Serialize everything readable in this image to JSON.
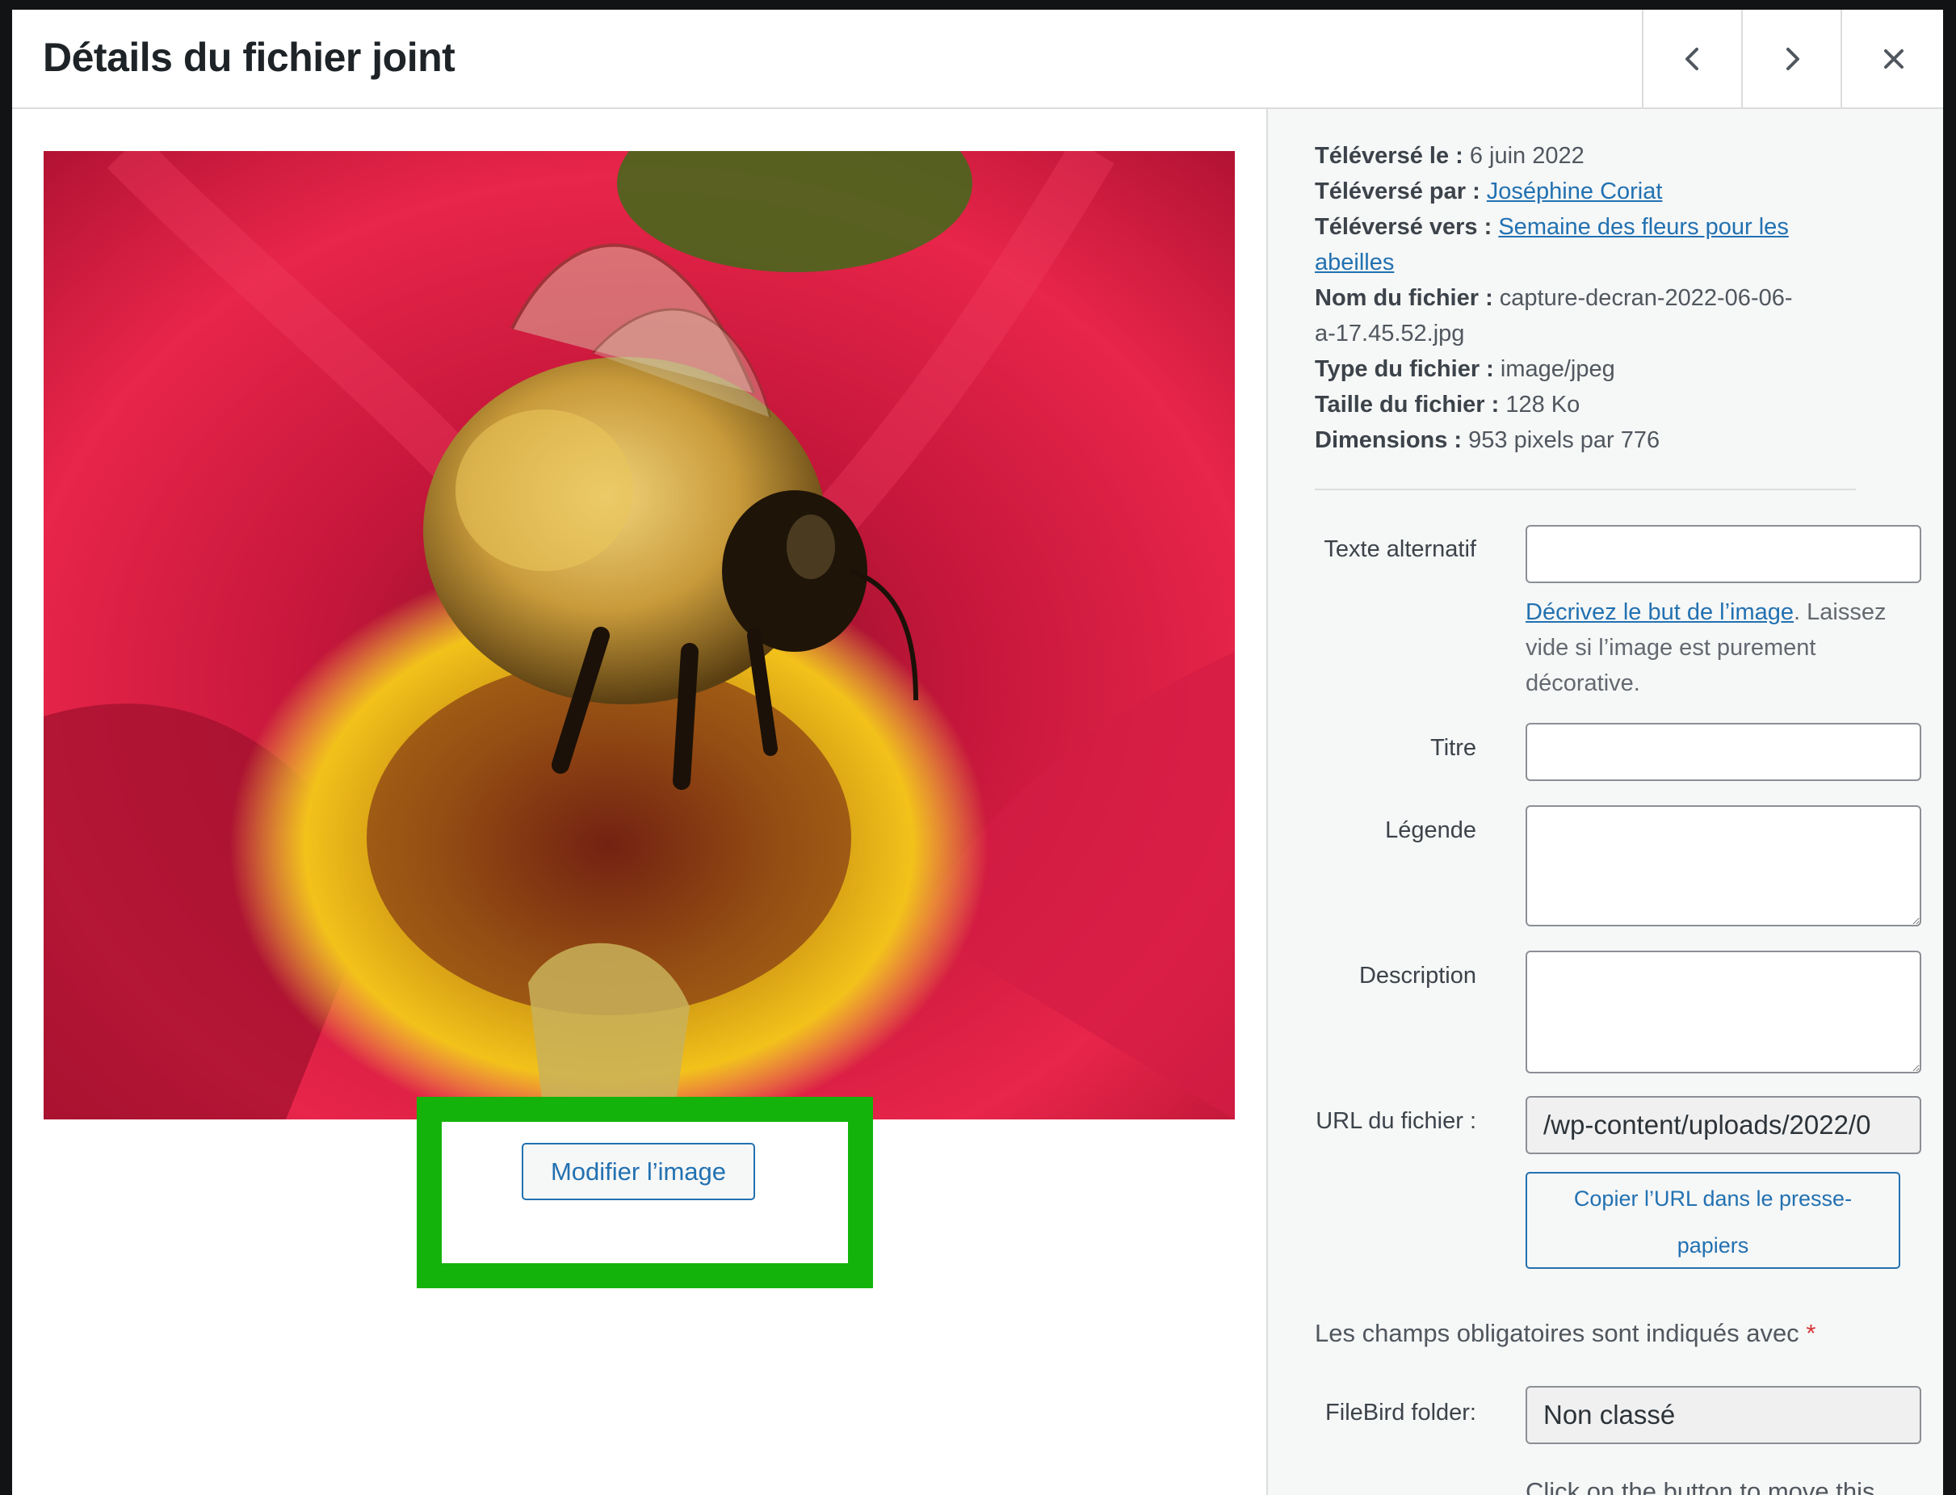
{
  "header": {
    "title": "Détails du fichier joint",
    "prev_icon": "chevron-left-icon",
    "next_icon": "chevron-right-icon",
    "close_icon": "close-icon"
  },
  "media": {
    "edit_button_label": "Modifier l’image",
    "highlight_color": "#14b30b"
  },
  "meta": {
    "uploaded_on_label": "Téléversé le :",
    "uploaded_on_value": "6 juin 2022",
    "uploaded_by_label": "Téléversé par :",
    "uploaded_by_value": "Joséphine Coriat",
    "uploaded_to_label": "Téléversé vers :",
    "uploaded_to_value_line1": "Semaine des fleurs pour les",
    "uploaded_to_value_line2": "abeilles",
    "filename_label": "Nom du fichier :",
    "filename_value_line1": "capture-decran-2022-06-06-",
    "filename_value_line2": "a-17.45.52.jpg",
    "filetype_label": "Type du fichier :",
    "filetype_value": "image/jpeg",
    "filesize_label": "Taille du fichier :",
    "filesize_value": "128 Ko",
    "dimensions_label": "Dimensions :",
    "dimensions_value": "953 pixels par 776"
  },
  "fields": {
    "alt_label": "Texte alternatif",
    "alt_value": "",
    "alt_help_link": "Décrivez le but de l’image",
    "alt_help_rest": ". Laissez vide si l’image est purement décorative.",
    "title_label": "Titre",
    "title_value": "",
    "caption_label": "Légende",
    "caption_value": "",
    "description_label": "Description",
    "description_value": "",
    "url_label": "URL du fichier :",
    "url_value": "/wp-content/uploads/2022/0",
    "copy_url_label": "Copier l’URL dans le presse-papiers",
    "required_note": "Les champs obligatoires sont indiqués avec",
    "required_star": "*",
    "folder_label": "FileBird folder:",
    "folder_value": "Non classé",
    "move_note": "Click on the button to move this"
  },
  "colors": {
    "accent": "#2271b1",
    "required": "#d63638",
    "sidebar_bg": "#f6f7f7"
  }
}
